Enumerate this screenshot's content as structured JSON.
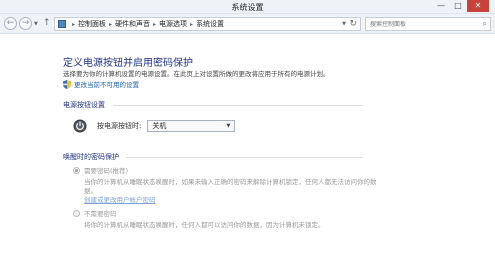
{
  "window": {
    "title": "系统设置"
  },
  "window_buttons": {
    "minimize": "—",
    "maximize": "□",
    "close": "✕"
  },
  "nav": {
    "back_glyph": "←",
    "forward_glyph": "→",
    "up_glyph": "↑",
    "refresh_glyph": "↻"
  },
  "breadcrumb": [
    "控制面板",
    "硬件和声音",
    "电源选项",
    "系统设置"
  ],
  "search": {
    "placeholder": "搜索控制面板"
  },
  "page": {
    "title": "定义电源按钮并启用密码保护",
    "description": "选择要为你的计算机设置的电源设置。在此页上对设置所做的更改将应用于所有的电源计划。",
    "change_link": "更改当前不可用的设置"
  },
  "power_button_settings": {
    "heading": "电源按钮设置",
    "label": "按电源按钮时:",
    "selected": "关机"
  },
  "wake_password": {
    "heading": "唤醒时的密码保护",
    "require_label": "需要密码(推荐)",
    "require_note_line1": "当你的计算机从睡眠状态唤醒时，如果未输入正确的密码来解除计算机锁定，任何人都无法访问你的数",
    "require_note_line2": "据。",
    "account_link": "创建或更改用户帐户密码",
    "no_require_label": "不需要密码",
    "no_require_note": "将你的计算机从睡眠状态唤醒时，任何人都可以访问你的数据，因为计算机未锁定。"
  },
  "icons": {
    "control_panel": "control-panel-icon",
    "shield": "uac-shield-icon",
    "power": "power-icon",
    "search": "search-icon"
  },
  "colors": {
    "heading": "#1e3287",
    "link": "#1a5fb4",
    "close": "#c7433a"
  }
}
